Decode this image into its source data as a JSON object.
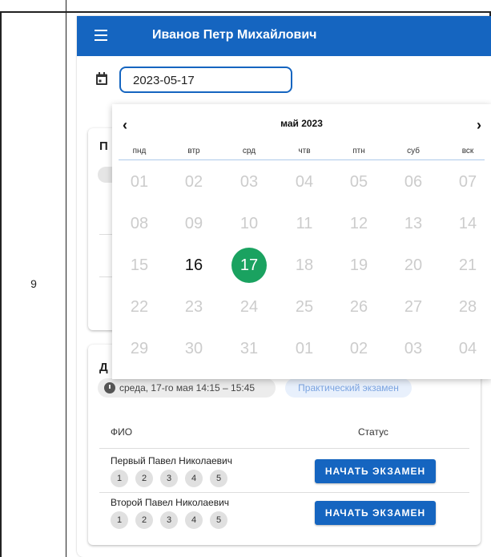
{
  "table": {
    "row_number": "9"
  },
  "appbar": {
    "title": "Иванов Петр Михайлович",
    "menu_icon": "menu-icon",
    "color": "#1565c0"
  },
  "date_field": {
    "value": "2023-05-17",
    "icon": "calendar-icon"
  },
  "calendar": {
    "month_label": "май 2023",
    "prev": "‹",
    "next": "›",
    "weekdays": [
      "пнд",
      "втр",
      "срд",
      "чтв",
      "птн",
      "суб",
      "вск"
    ],
    "weeks": [
      [
        "01",
        "02",
        "03",
        "04",
        "05",
        "06",
        "07"
      ],
      [
        "08",
        "09",
        "10",
        "11",
        "12",
        "13",
        "14"
      ],
      [
        "15",
        "16",
        "17",
        "18",
        "19",
        "20",
        "21"
      ],
      [
        "22",
        "23",
        "24",
        "25",
        "26",
        "27",
        "28"
      ],
      [
        "29",
        "30",
        "31",
        "01",
        "02",
        "03",
        "04"
      ]
    ],
    "enabled_days": [
      "16",
      "17"
    ],
    "selected_day": "17",
    "selected_color": "#1aa260"
  },
  "card1": {
    "title_partial": "П"
  },
  "card2": {
    "title_partial": "Д",
    "time_chip": "среда, 17-го мая 14:15 – 15:45",
    "type_chip": "Практический экзамен",
    "col_name": "ФИО",
    "col_status": "Статус",
    "students": [
      {
        "name": "Первый Павел Николаевич",
        "steps": [
          "1",
          "2",
          "3",
          "4",
          "5"
        ],
        "action": "НАЧАТЬ ЭКЗАМЕН"
      },
      {
        "name": "Второй Павел Николаевич",
        "steps": [
          "1",
          "2",
          "3",
          "4",
          "5"
        ],
        "action": "НАЧАТЬ ЭКЗАМЕН"
      }
    ]
  }
}
